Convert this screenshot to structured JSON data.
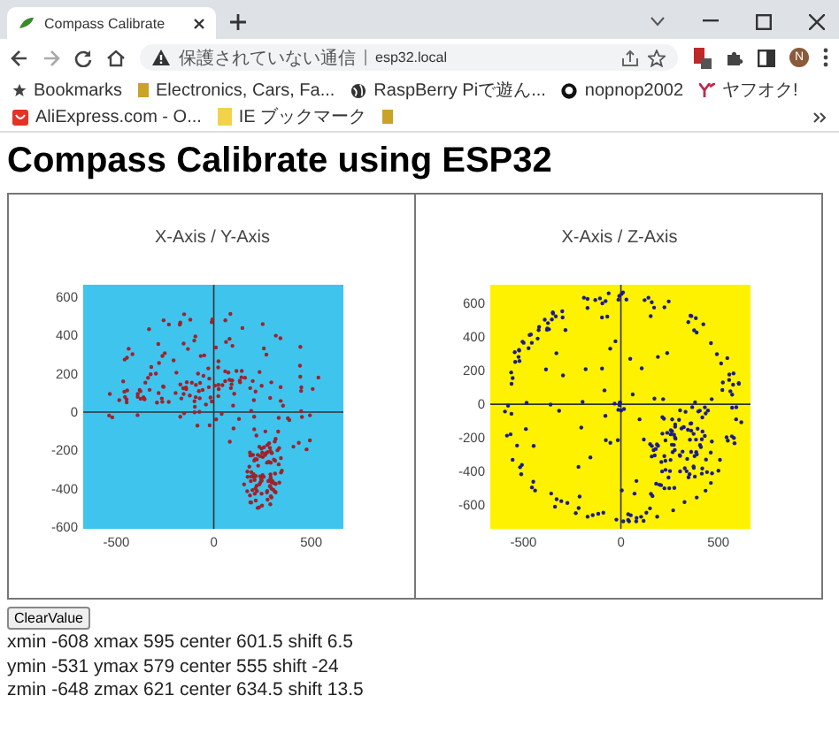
{
  "browser": {
    "tabs": [
      {
        "title": "Compass Calibrate",
        "selected": true
      }
    ],
    "security_label": "保護されていない通信",
    "url": "esp32.local",
    "profile_initial": "N",
    "bookmarks": [
      {
        "label": "Bookmarks",
        "kind": "star"
      },
      {
        "label": "Electronics, Cars, Fa...",
        "kind": "folder"
      },
      {
        "label": "RaspBerry Piで遊ん...",
        "kind": "globe"
      },
      {
        "label": "nopnop2002",
        "kind": "github"
      },
      {
        "label": "ヤフオク!",
        "kind": "yahoo"
      },
      {
        "label": "AliExpress.com - O...",
        "kind": "ali"
      },
      {
        "label": "IE ブックマーク",
        "kind": "note"
      }
    ]
  },
  "page": {
    "heading": "Compass Calibrate using ESP32",
    "charts": [
      {
        "chart_data": {
          "type": "scatter",
          "title": "X-Axis / Y-Axis",
          "xlim": [
            -670,
            665
          ],
          "ylim": [
            -610,
            665
          ],
          "xticks": [
            -500,
            0,
            500
          ],
          "yticks": [
            -600,
            -400,
            -200,
            0,
            200,
            400,
            600
          ]
        }
      },
      {
        "chart_data": {
          "type": "scatter",
          "title": "X-Axis / Z-Axis",
          "xlim": [
            -670,
            665
          ],
          "ylim": [
            -740,
            710
          ],
          "xticks": [
            -500,
            0,
            500
          ],
          "yticks": [
            -600,
            -400,
            -200,
            0,
            200,
            400,
            600
          ]
        }
      }
    ],
    "button": "ClearValue",
    "lines": [
      "xmin -608 xmax 595 center 601.5 shift 6.5",
      "ymin -531 ymax 579 center 555 shift -24",
      "zmin -648 zmax 621 center 634.5 shift 13.5"
    ]
  }
}
